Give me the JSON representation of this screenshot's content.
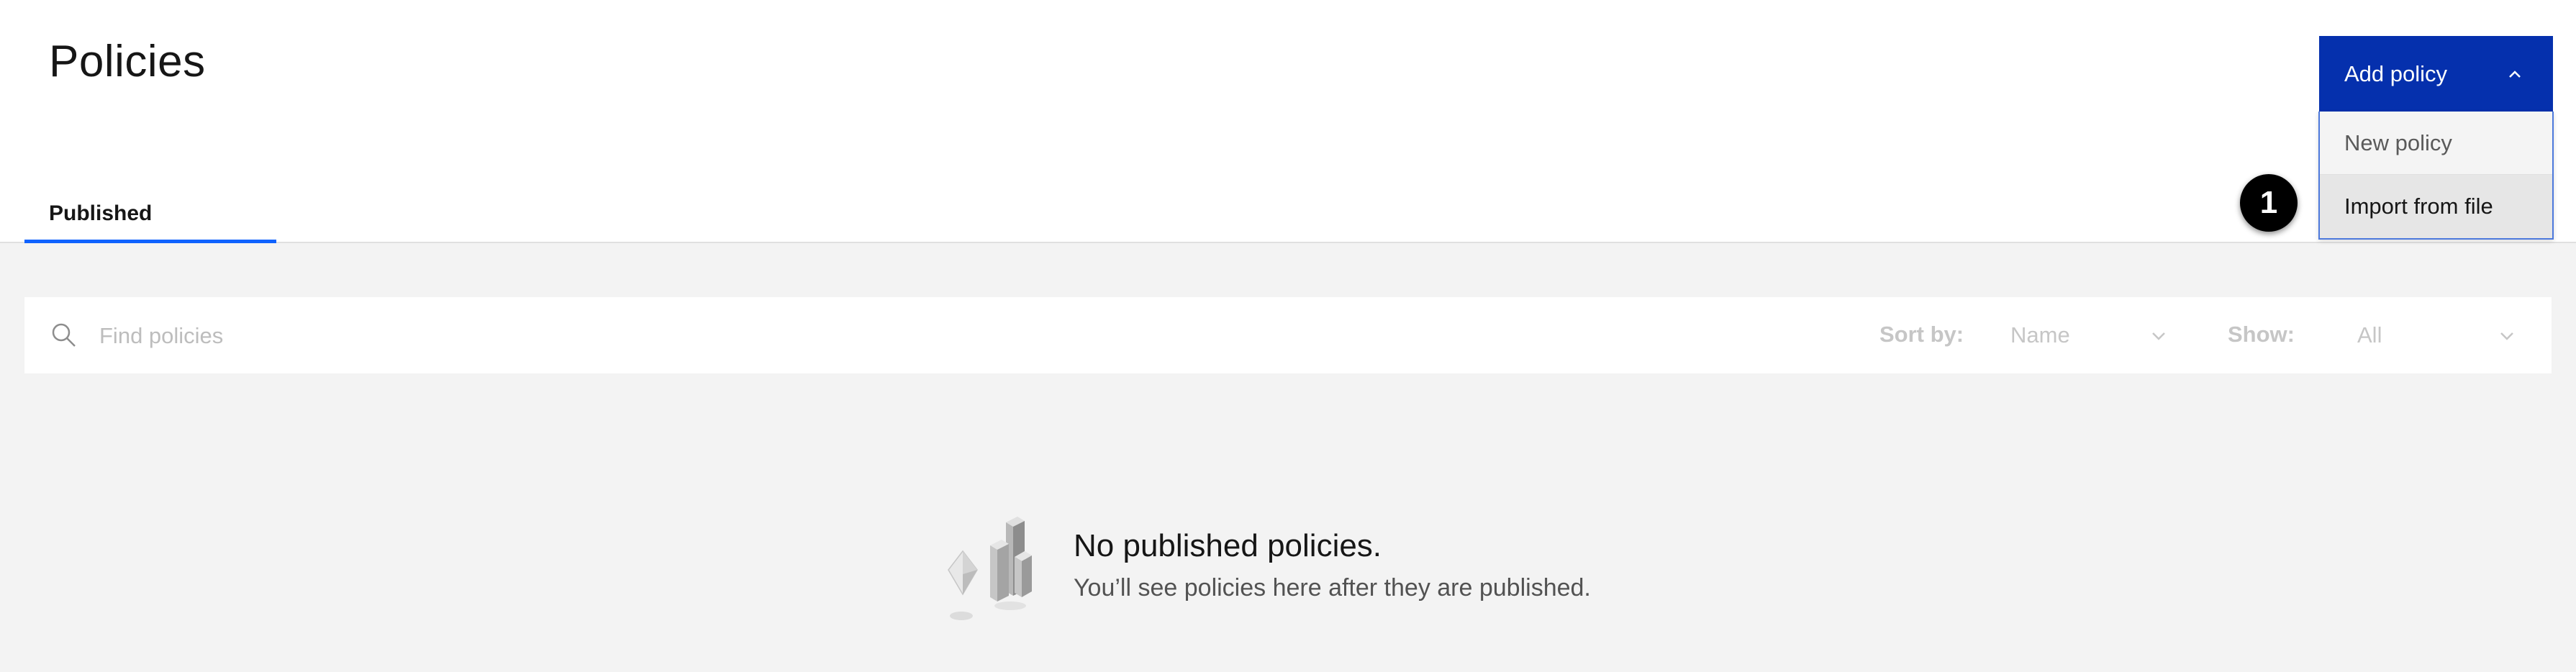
{
  "header": {
    "title": "Policies",
    "tabs": [
      {
        "label": "Published"
      }
    ]
  },
  "add_policy": {
    "label": "Add policy",
    "menu": [
      {
        "label": "New policy"
      },
      {
        "label": "Import from file"
      }
    ]
  },
  "callout": {
    "number": "1"
  },
  "toolbar": {
    "search_placeholder": "Find policies",
    "sort_label": "Sort by:",
    "sort_value": "Name",
    "show_label": "Show:",
    "show_value": "All"
  },
  "empty_state": {
    "title": "No published policies.",
    "subtitle": "You’ll see policies here after they are published."
  },
  "colors": {
    "primary_button": "#0530ad",
    "tab_indicator": "#0f62fe",
    "background": "#f3f3f3"
  }
}
